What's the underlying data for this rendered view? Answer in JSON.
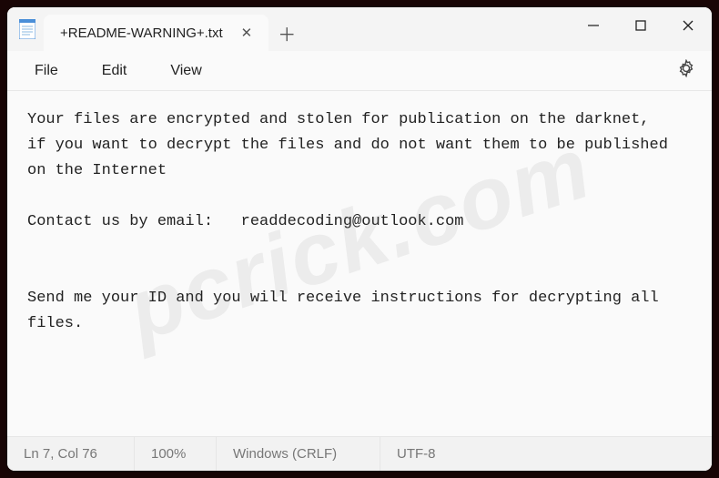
{
  "window": {
    "tab_title": "+README-WARNING+.txt"
  },
  "menu": {
    "file": "File",
    "edit": "Edit",
    "view": "View"
  },
  "content": {
    "body": "Your files are encrypted and stolen for publication on the darknet,\nif you want to decrypt the files and do not want them to be published on the Internet\n\nContact us by email:   readdecoding@outlook.com\n\n\nSend me your ID and you will receive instructions for decrypting all files."
  },
  "status": {
    "position": "Ln 7, Col 76",
    "zoom": "100%",
    "line_ending": "Windows (CRLF)",
    "encoding": "UTF-8"
  },
  "watermark": "pcrick.com"
}
